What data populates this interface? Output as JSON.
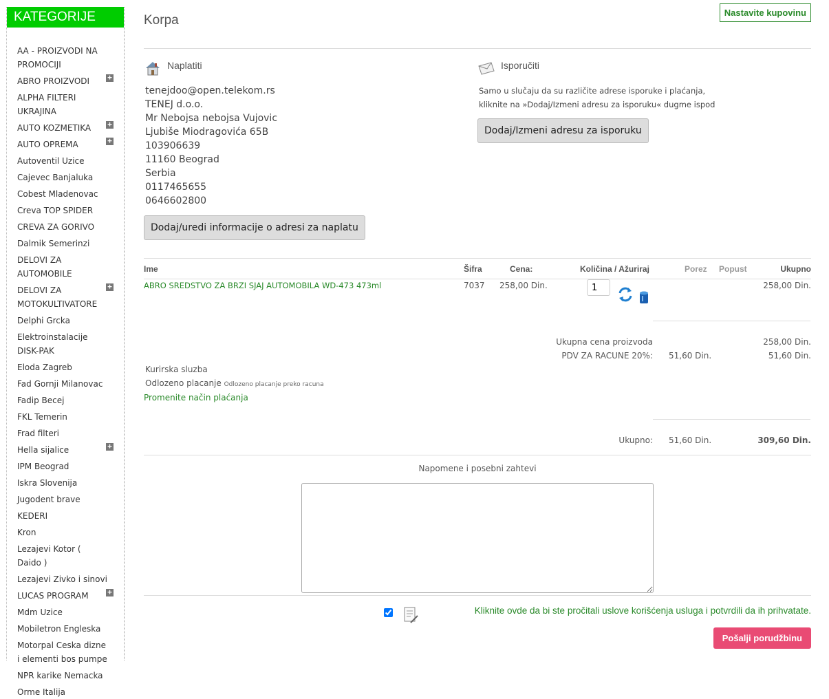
{
  "sidebar": {
    "header": "KATEGORIJE",
    "items": [
      {
        "label": "AA - PROIZVODI NA PROMOCIJI",
        "expandable": false
      },
      {
        "label": "ABRO PROIZVODI",
        "expandable": true
      },
      {
        "label": "ALPHA FILTERI UKRAJINA",
        "expandable": false
      },
      {
        "label": "AUTO KOZMETIKA",
        "expandable": true
      },
      {
        "label": "AUTO OPREMA",
        "expandable": true
      },
      {
        "label": "Autoventil Uzice",
        "expandable": false
      },
      {
        "label": "Cajevec Banjaluka",
        "expandable": false
      },
      {
        "label": "Cobest Mladenovac",
        "expandable": false
      },
      {
        "label": "Creva TOP SPIDER",
        "expandable": false
      },
      {
        "label": "CREVA ZA GORIVO",
        "expandable": false
      },
      {
        "label": "Dalmik Semerinzi",
        "expandable": false
      },
      {
        "label": "DELOVI ZA AUTOMOBILE",
        "expandable": false
      },
      {
        "label": "DELOVI ZA MOTOKULTIVATORE",
        "expandable": true
      },
      {
        "label": "Delphi Grcka",
        "expandable": false
      },
      {
        "label": "Elektroinstalacije DISK-PAK",
        "expandable": false
      },
      {
        "label": "Eloda Zagreb",
        "expandable": false
      },
      {
        "label": "Fad Gornji Milanovac",
        "expandable": false
      },
      {
        "label": "Fadip Becej",
        "expandable": false
      },
      {
        "label": "FKL Temerin",
        "expandable": false
      },
      {
        "label": "Frad filteri",
        "expandable": false
      },
      {
        "label": "Hella sijalice",
        "expandable": true
      },
      {
        "label": "IPM Beograd",
        "expandable": false
      },
      {
        "label": "Iskra Slovenija",
        "expandable": false
      },
      {
        "label": "Jugodent brave",
        "expandable": false
      },
      {
        "label": "KEDERI",
        "expandable": false
      },
      {
        "label": "Kron",
        "expandable": false
      },
      {
        "label": "Lezajevi Kotor ( Daido )",
        "expandable": false
      },
      {
        "label": "Lezajevi Zivko i sinovi",
        "expandable": false
      },
      {
        "label": "LUCAS PROGRAM",
        "expandable": true
      },
      {
        "label": "Mdm Uzice",
        "expandable": false
      },
      {
        "label": "Mobiletron Engleska",
        "expandable": false
      },
      {
        "label": "Motorpal Ceska dizne i elementi bos pumpe",
        "expandable": false
      },
      {
        "label": "NPR karike Nemacka",
        "expandable": false
      },
      {
        "label": "Orme Italija",
        "expandable": false
      }
    ]
  },
  "page": {
    "title": "Korpa",
    "continue_label": "Nastavite kupovinu"
  },
  "billing": {
    "heading": "Naplatiti",
    "lines": [
      "tenejdoo@open.telekom.rs",
      "TENEJ d.o.o.",
      "Mr Nebojsa nebojsa Vujovic",
      "Ljubiše Miodragovića 65B",
      "103906639",
      "11160 Beograd",
      "Serbia",
      "0117465655",
      "0646602800"
    ],
    "button": "Dodaj/uredi informacije o adresi za naplatu"
  },
  "shipping": {
    "heading": "Isporučiti",
    "note_line1": "Samo u slučaju da su različite adrese isporuke i plaćanja,",
    "note_line2": "kliknite na »Dodaj/Izmeni adresu za isporuku« dugme ispod",
    "button": "Dodaj/Izmeni adresu za isporuku"
  },
  "cart": {
    "headers": {
      "name": "Ime",
      "sku": "Šifra",
      "price": "Cena:",
      "qty": "Količina / Ažuriraj",
      "tax": "Porez",
      "discount": "Popust",
      "total": "Ukupno"
    },
    "item": {
      "name": "ABRO SREDSTVO ZA BRZI SJAJ AUTOMOBILA WD-473 473ml",
      "sku": "7037",
      "price": "258,00 Din.",
      "qty": "1",
      "total": "258,00 Din."
    },
    "subtotal_label": "Ukupna cena proizvoda",
    "subtotal_value": "258,00 Din.",
    "vat_label": "PDV ZA RACUNE 20%:",
    "vat_tax": "51,60 Din.",
    "vat_value": "51,60 Din.",
    "shipping_method": "Kurirska sluzba",
    "payment_method": "Odlozeno placanje",
    "payment_note": "Odlozeno placanje preko racuna",
    "change_payment": "Promenite način plaćanja",
    "grand_label": "Ukupno:",
    "grand_tax": "51,60 Din.",
    "grand_total": "309,60 Din."
  },
  "notes": {
    "label": "Napomene i posebni zahtevi",
    "value": ""
  },
  "terms": {
    "text": "Kliknite ovde da bi ste pročitali uslove korišćenja usluga i potvrdili da ih prihvatate.",
    "checked": true
  },
  "submit_label": "Pošalji porudžbinu"
}
